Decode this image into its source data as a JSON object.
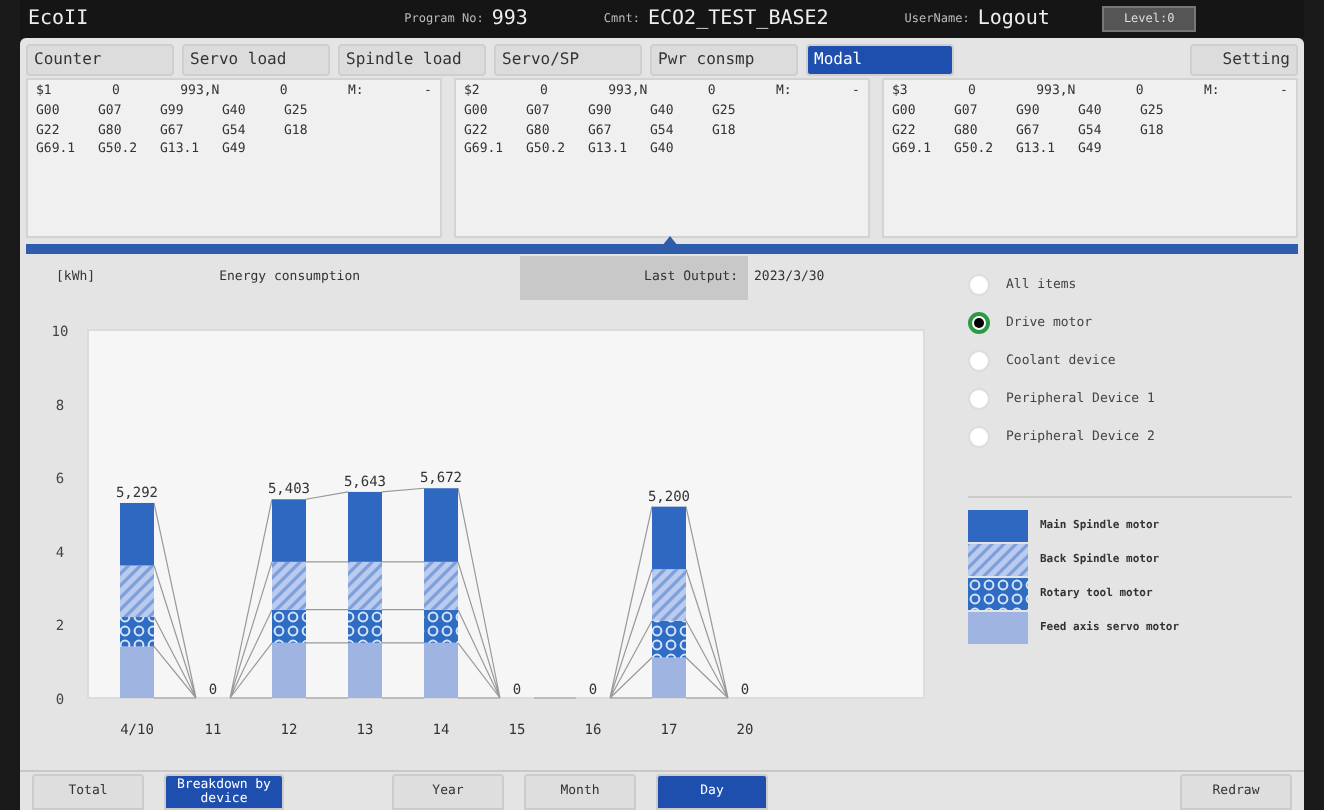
{
  "header": {
    "app_name": "EcoII",
    "program_label": "Program No:",
    "program_value": "993",
    "comment_label": "Cmnt:",
    "comment_value": "ECO2_TEST_BASE2",
    "user_label": "UserName:",
    "user_value": "Logout",
    "level_button": "Level:0"
  },
  "tabs": [
    {
      "label": "Counter",
      "selected": false
    },
    {
      "label": "Servo load",
      "selected": false
    },
    {
      "label": "Spindle load",
      "selected": false
    },
    {
      "label": "Servo/SP",
      "selected": false
    },
    {
      "label": "Pwr consmp",
      "selected": false
    },
    {
      "label": "Modal",
      "selected": true
    }
  ],
  "setting_button": "Setting",
  "modal_panels": [
    {
      "header": [
        "$1",
        "0",
        "993,N",
        "0",
        "M:",
        "-"
      ],
      "rows": [
        [
          "G00",
          "G07",
          "G99",
          "G40",
          "G25"
        ],
        [
          "G22",
          "G80",
          "G67",
          "G54",
          "G18"
        ],
        [
          "G69.1",
          "G50.2",
          "G13.1",
          "G49"
        ]
      ]
    },
    {
      "header": [
        "$2",
        "0",
        "993,N",
        "0",
        "M:",
        "-"
      ],
      "rows": [
        [
          "G00",
          "G07",
          "G90",
          "G40",
          "G25"
        ],
        [
          "G22",
          "G80",
          "G67",
          "G54",
          "G18"
        ],
        [
          "G69.1",
          "G50.2",
          "G13.1",
          "G40"
        ]
      ]
    },
    {
      "header": [
        "$3",
        "0",
        "993,N",
        "0",
        "M:",
        "-"
      ],
      "rows": [
        [
          "G00",
          "G07",
          "G90",
          "G40",
          "G25"
        ],
        [
          "G22",
          "G80",
          "G67",
          "G54",
          "G18"
        ],
        [
          "G69.1",
          "G50.2",
          "G13.1",
          "G49"
        ]
      ]
    }
  ],
  "energy": {
    "unit": "[kWh]",
    "title": "Energy consumption",
    "last_output_label": "Last Output:",
    "last_output_date": "2023/3/30",
    "chart_data": {
      "type": "bar",
      "stacked": true,
      "categories": [
        "4/10",
        "11",
        "12",
        "13",
        "14",
        "15",
        "16",
        "17",
        "20"
      ],
      "ylim": [
        0,
        10
      ],
      "yticks": [
        0,
        2,
        4,
        6,
        8,
        10
      ],
      "series": [
        {
          "name": "Feed axis servo motor",
          "color": "#9fb4e0",
          "values": [
            1.4,
            0,
            1.5,
            1.5,
            1.5,
            0,
            0,
            1.1,
            0
          ]
        },
        {
          "name": "Rotary tool motor",
          "color": "#2f6cc4",
          "values": [
            0.8,
            0,
            0.9,
            0.9,
            0.9,
            0,
            0,
            1.0,
            0
          ]
        },
        {
          "name": "Back Spindle motor",
          "color": "#7d9fdc",
          "values": [
            1.4,
            0,
            1.3,
            1.3,
            1.3,
            0,
            0,
            1.4,
            0
          ]
        },
        {
          "name": "Main Spindle motor",
          "color": "#2f68c0",
          "values": [
            1.7,
            0,
            1.7,
            1.9,
            2.0,
            0,
            0,
            1.7,
            0
          ]
        }
      ],
      "value_labels": [
        "5,292",
        "0",
        "5,403",
        "5,643",
        "5,672",
        "0",
        "0",
        "5,200",
        "0"
      ]
    },
    "legend": [
      {
        "kind": "solid"
      },
      {
        "kind": "hatch"
      },
      {
        "kind": "dots"
      },
      {
        "kind": "solid"
      }
    ]
  },
  "device_options": [
    {
      "label": "All items",
      "selected": false
    },
    {
      "label": "Drive motor",
      "selected": true
    },
    {
      "label": "Coolant device",
      "selected": false
    },
    {
      "label": "Peripheral Device 1",
      "selected": false
    },
    {
      "label": "Peripheral Device 2",
      "selected": false
    }
  ],
  "bottom_buttons": [
    {
      "label": "Total",
      "selected": false
    },
    {
      "label": "Breakdown by device",
      "selected": true
    },
    {
      "label": "Year",
      "selected": false
    },
    {
      "label": "Month",
      "selected": false
    },
    {
      "label": "Day",
      "selected": true
    }
  ],
  "redraw_button": "Redraw"
}
